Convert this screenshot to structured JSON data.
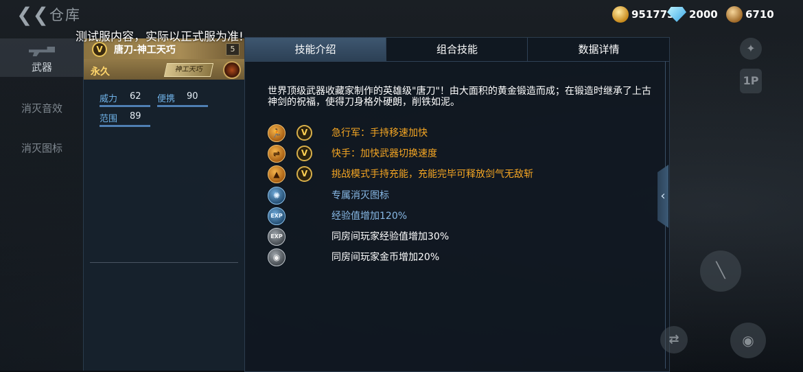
{
  "topbar": {
    "back_icon": "double-chevron-left-icon",
    "title": "仓库",
    "currencies": [
      {
        "icon": "gold-coin-icon",
        "value": "951773"
      },
      {
        "icon": "diamond-icon",
        "value": "2000"
      },
      {
        "icon": "medal-icon",
        "value": "6710"
      }
    ]
  },
  "notice": "测试服内容，实际以正式服为准!",
  "leftnav": {
    "items": [
      {
        "label": "武器",
        "active": true
      },
      {
        "label": "消灭音效",
        "active": false
      },
      {
        "label": "消灭图标",
        "active": false
      }
    ]
  },
  "item": {
    "name": "唐刀-神工天巧",
    "level": "5",
    "duration": "永久",
    "tag": "神工天巧",
    "stats": [
      {
        "label": "威力",
        "value": "62"
      },
      {
        "label": "便携",
        "value": "90"
      },
      {
        "label": "范围",
        "value": "89"
      }
    ]
  },
  "detail": {
    "tabs": [
      "技能介绍",
      "组合技能",
      "数据详情"
    ],
    "active_tab": 0,
    "description": "世界顶级武器收藏家制作的英雄级\"唐刀\"！由大面积的黄金锻造而成；在锻造时继承了上古神剑的祝福，使得刀身格外硬朗，削铁如泥。",
    "skills": [
      {
        "icon": "running-man-icon",
        "icon_color": "gold",
        "has_v": true,
        "text": "急行军：手持移速加快",
        "text_color": "gold"
      },
      {
        "icon": "weapon-switch-icon",
        "icon_color": "gold",
        "has_v": true,
        "text": "快手：加快武器切换速度",
        "text_color": "gold"
      },
      {
        "icon": "energy-charge-icon",
        "icon_color": "gold",
        "has_v": true,
        "text": "挑战模式手持充能，充能完毕可释放剑气无敌斩",
        "text_color": "gold"
      },
      {
        "icon": "kill-icon-badge",
        "icon_color": "blue",
        "has_v": false,
        "text": "专属消灭图标",
        "text_color": "blue"
      },
      {
        "icon": "exp-icon",
        "icon_color": "blue",
        "has_v": false,
        "text": "经验值增加120%",
        "text_color": "blue"
      },
      {
        "icon": "room-exp-icon",
        "icon_color": "grey",
        "has_v": false,
        "text": "同房间玩家经验值增加30%",
        "text_color": "white"
      },
      {
        "icon": "room-coin-icon",
        "icon_color": "grey",
        "has_v": false,
        "text": "同房间玩家金币增加20%",
        "text_color": "white"
      }
    ]
  },
  "right_controls": {
    "view_label": "1P"
  }
}
